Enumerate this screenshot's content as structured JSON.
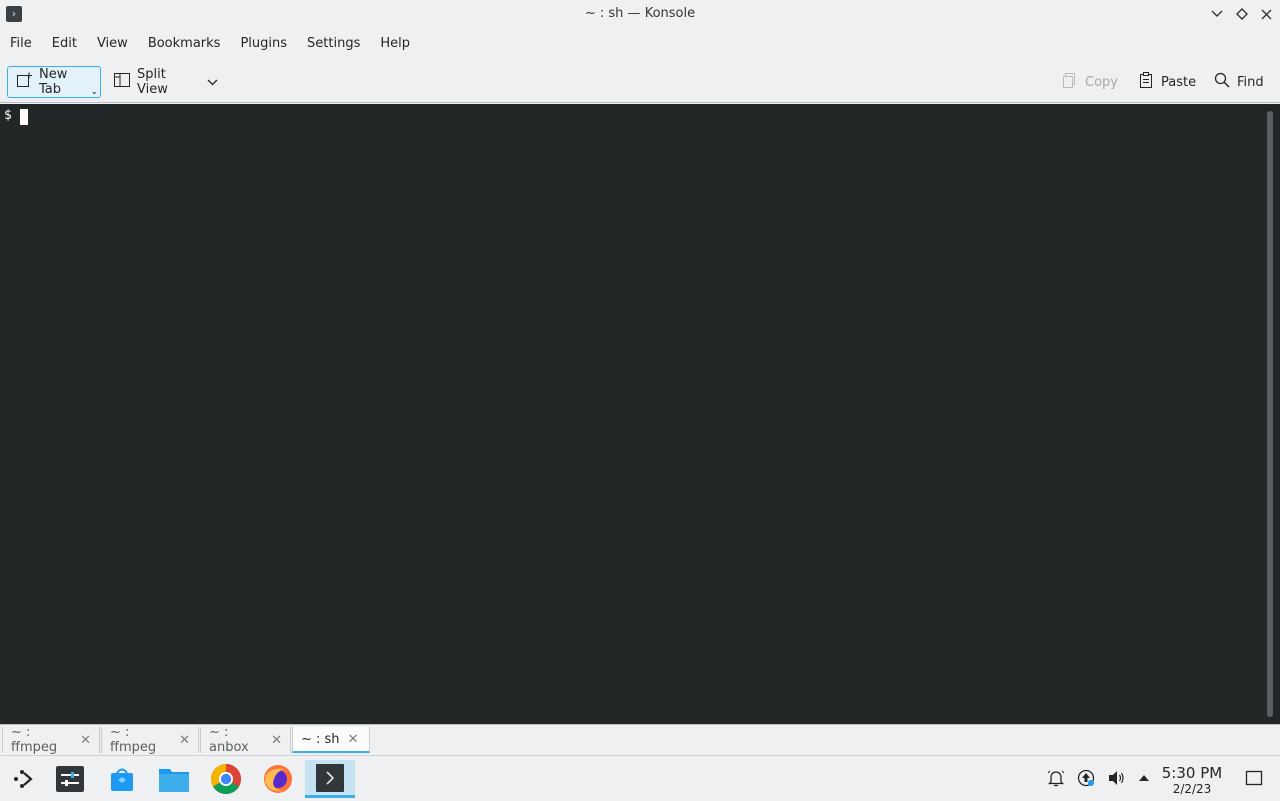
{
  "window": {
    "title": "~ : sh — Konsole"
  },
  "menubar": {
    "items": [
      "File",
      "Edit",
      "View",
      "Bookmarks",
      "Plugins",
      "Settings",
      "Help"
    ]
  },
  "toolbar": {
    "new_tab_label": "New Tab",
    "split_view_label": "Split View",
    "copy_label": "Copy",
    "paste_label": "Paste",
    "find_label": "Find"
  },
  "terminal": {
    "prompt": "$"
  },
  "tabs": [
    {
      "label": "~ : ffmpeg",
      "active": false
    },
    {
      "label": "~ : ffmpeg",
      "active": false
    },
    {
      "label": "~ : anbox",
      "active": false
    },
    {
      "label": "~ : sh",
      "active": true
    }
  ],
  "taskbar": {
    "apps": [
      "app-launcher-icon",
      "system-settings-icon",
      "discover-store-icon",
      "file-manager-icon",
      "chrome-icon",
      "firefox-icon",
      "konsole-icon"
    ],
    "active_app": "konsole-icon"
  },
  "clock": {
    "time": "5:30 PM",
    "date": "2/2/23"
  },
  "colors": {
    "accent": "#3daee9",
    "terminal_bg": "#232627"
  }
}
